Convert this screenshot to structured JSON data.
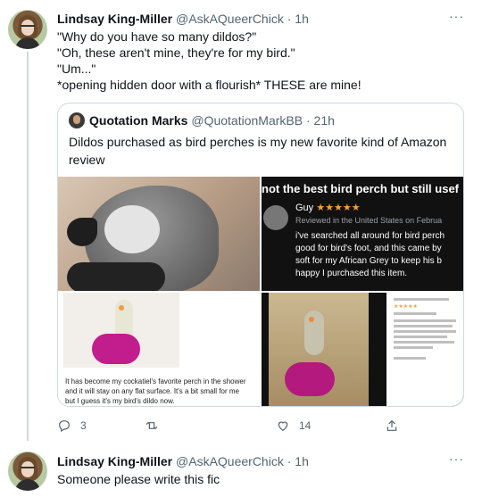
{
  "tweet1": {
    "name": "Lindsay King-Miller",
    "handle": "@AskAQueerChick",
    "dot": "·",
    "time": "1h",
    "more": "···",
    "lines": [
      "\"Why do you have so many dildos?\"",
      "\"Oh, these aren't mine, they're for my bird.\"",
      "\"Um...\"",
      "*opening hidden door with a flourish* THESE are mine!"
    ],
    "actions": {
      "reply_count": "3",
      "retweet_count": "",
      "like_count": "14"
    }
  },
  "quote": {
    "name": "Quotation Marks",
    "handle": "@QuotationMarkBB",
    "dot": "·",
    "time": "21h",
    "text": "Dildos purchased as bird perches is my new favorite kind of Amazon review",
    "review_image": {
      "headline": "not the best bird perch but still usef",
      "reviewer": "Guy",
      "stars": "★★★★★",
      "reviewed_in": "Reviewed in the United States on Februa",
      "body": [
        "i've searched all around for bird perch",
        "good for bird's foot, and this came by",
        "soft for my African Grey to keep his b",
        "happy I purchased this item."
      ]
    },
    "caption_image": {
      "caption": [
        "It has become my cockatiel's favorite perch in the shower",
        "and it will stay on any flat surface. It's a bit small for me",
        "but I guess it's my bird's dildo now."
      ]
    }
  },
  "tweet2": {
    "name": "Lindsay King-Miller",
    "handle": "@AskAQueerChick",
    "dot": "·",
    "time": "1h",
    "more": "···",
    "text": "Someone please write this fic"
  },
  "colors": {
    "text": "#0f1419",
    "secondary": "#536471",
    "border": "#cfd9de",
    "link": "#1d9bf0"
  }
}
